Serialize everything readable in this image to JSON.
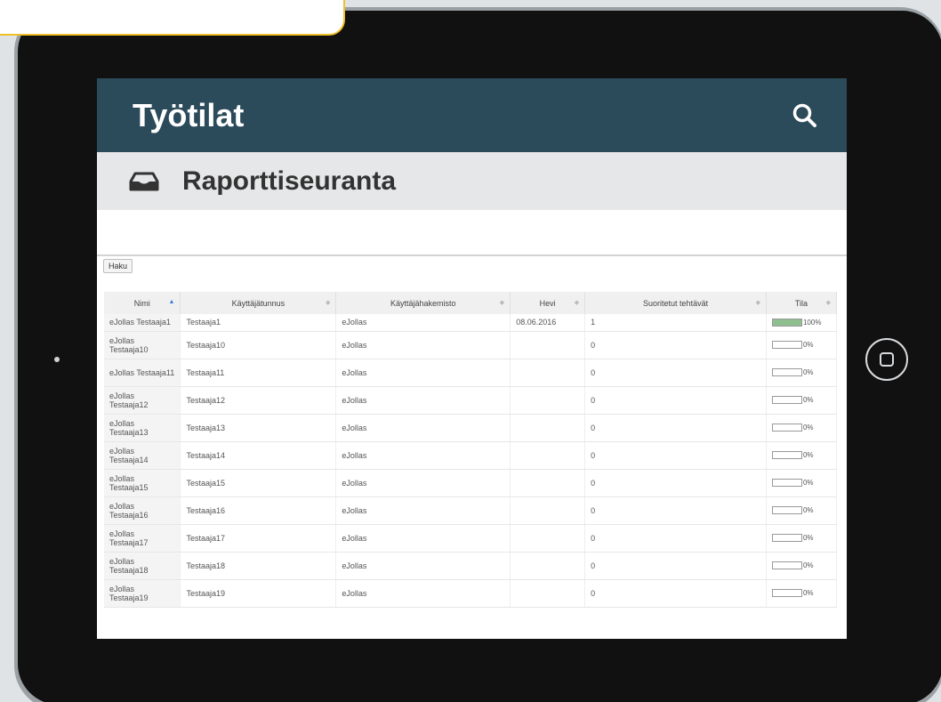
{
  "app": {
    "title": "Työtilat"
  },
  "subheader": {
    "title": "Raporttiseuranta"
  },
  "toolbar": {
    "haku_label": "Haku"
  },
  "table": {
    "headers": [
      "Nimi",
      "Käyttäjätunnus",
      "Käyttäjähakemisto",
      "Hevi",
      "Suoritetut tehtävät",
      "Tila"
    ],
    "rows": [
      {
        "name": "eJollas Testaaja1",
        "username": "Testaaja1",
        "directory": "eJollas",
        "date": "08.06.2016",
        "completed": "1",
        "status": "100%",
        "progress": 1.0
      },
      {
        "name": "eJollas Testaaja10",
        "username": "Testaaja10",
        "directory": "eJollas",
        "date": "",
        "completed": "0",
        "status": "0%",
        "progress": 0
      },
      {
        "name": "eJollas Testaaja11",
        "username": "Testaaja11",
        "directory": "eJollas",
        "date": "",
        "completed": "0",
        "status": "0%",
        "progress": 0
      },
      {
        "name": "eJollas Testaaja12",
        "username": "Testaaja12",
        "directory": "eJollas",
        "date": "",
        "completed": "0",
        "status": "0%",
        "progress": 0
      },
      {
        "name": "eJollas Testaaja13",
        "username": "Testaaja13",
        "directory": "eJollas",
        "date": "",
        "completed": "0",
        "status": "0%",
        "progress": 0
      },
      {
        "name": "eJollas Testaaja14",
        "username": "Testaaja14",
        "directory": "eJollas",
        "date": "",
        "completed": "0",
        "status": "0%",
        "progress": 0
      },
      {
        "name": "eJollas Testaaja15",
        "username": "Testaaja15",
        "directory": "eJollas",
        "date": "",
        "completed": "0",
        "status": "0%",
        "progress": 0
      },
      {
        "name": "eJollas Testaaja16",
        "username": "Testaaja16",
        "directory": "eJollas",
        "date": "",
        "completed": "0",
        "status": "0%",
        "progress": 0
      },
      {
        "name": "eJollas Testaaja17",
        "username": "Testaaja17",
        "directory": "eJollas",
        "date": "",
        "completed": "0",
        "status": "0%",
        "progress": 0
      },
      {
        "name": "eJollas Testaaja18",
        "username": "Testaaja18",
        "directory": "eJollas",
        "date": "",
        "completed": "0",
        "status": "0%",
        "progress": 0
      },
      {
        "name": "eJollas Testaaja19",
        "username": "Testaaja19",
        "directory": "eJollas",
        "date": "",
        "completed": "0",
        "status": "0%",
        "progress": 0
      }
    ]
  },
  "icons": {
    "search": "search-icon",
    "inbox": "inbox-icon",
    "home": "home-button-icon",
    "sort": "sort-icon"
  },
  "colors": {
    "header_bg": "#2b4a5a",
    "subheader_bg": "#e6e7e8",
    "progress_fill": "#8fbf8f",
    "accent": "#f0c028"
  }
}
